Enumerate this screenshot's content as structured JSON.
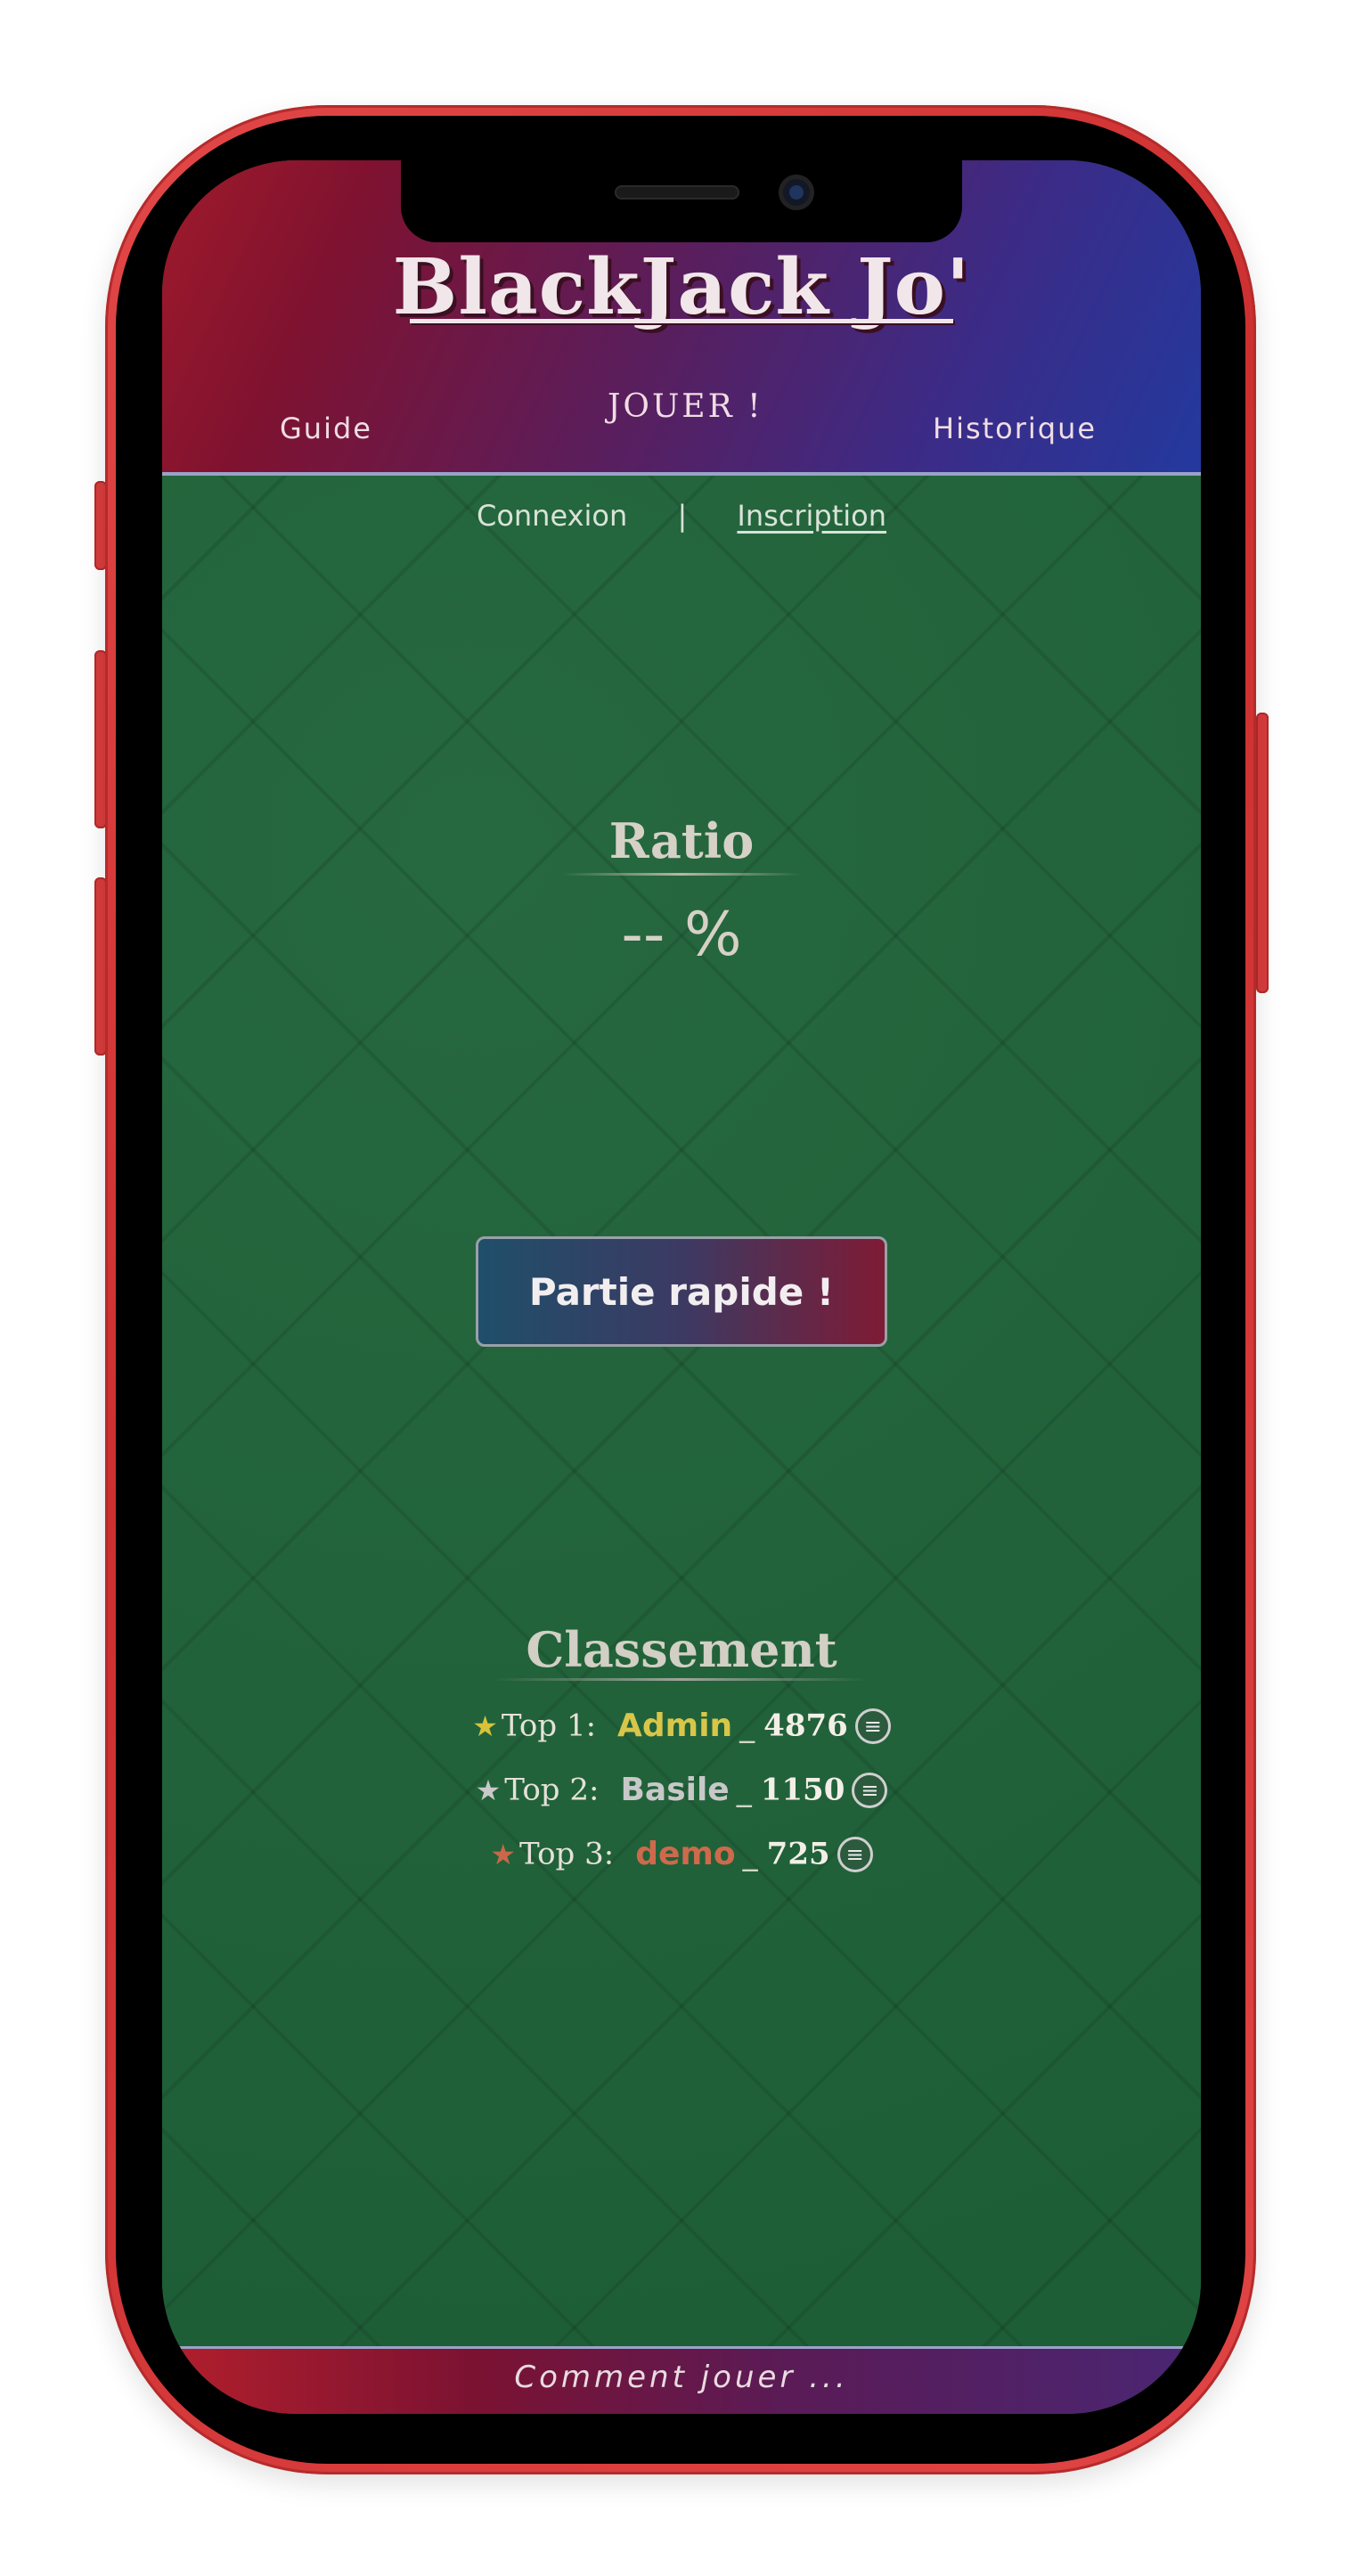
{
  "header": {
    "title": "BlackJack Jo'",
    "nav": {
      "guide": "Guide",
      "play": "JOUER !",
      "history": "Historique"
    }
  },
  "auth": {
    "login": "Connexion",
    "separator": "|",
    "signup": "Inscription"
  },
  "ratio": {
    "title": "Ratio",
    "value": "-- %"
  },
  "quick_game": {
    "label": "Partie rapide !"
  },
  "ranking": {
    "title": "Classement",
    "entries": [
      {
        "label": "Top 1:",
        "name": "Admin",
        "separator": "_",
        "score": "4876",
        "star_color": "#d7c23a",
        "name_color": "#d8c64a",
        "icon": "chip-icon"
      },
      {
        "label": "Top 2:",
        "name": "Basile",
        "separator": "_",
        "score": "1150",
        "star_color": "#c9c9c9",
        "name_color": "#c8c8c8",
        "icon": "chip-icon"
      },
      {
        "label": "Top 3:",
        "name": "demo",
        "separator": "_",
        "score": "725",
        "star_color": "#c8674a",
        "name_color": "#cd6a4c",
        "icon": "chip-icon"
      }
    ]
  },
  "footer": {
    "text": "Comment jouer ..."
  },
  "colors": {
    "frame": "#e24848",
    "felt": "#1f6339"
  }
}
